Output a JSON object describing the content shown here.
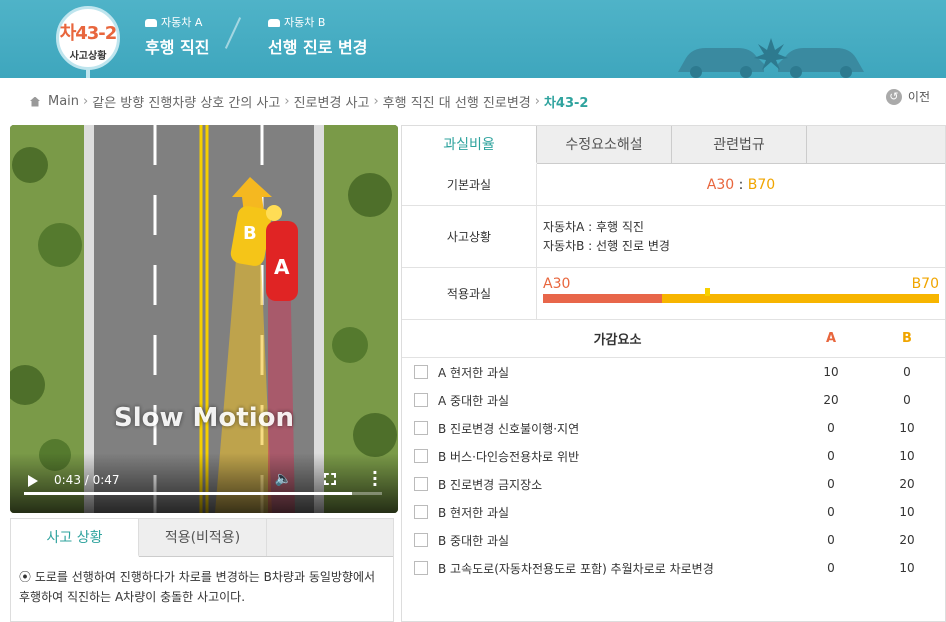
{
  "header": {
    "badge_code": "차43-2",
    "badge_sub": "사고상황",
    "car_a_label": "자동차 A",
    "car_a_action": "후행 직진",
    "car_b_label": "자동차 B",
    "car_b_action": "선행 진로 변경"
  },
  "breadcrumb": [
    "Main",
    "같은 방향 진행차량 상호 간의 사고",
    "진로변경 사고",
    "후행 직진 대 선행 진로변경",
    "차43-2"
  ],
  "back_label": "이전",
  "video": {
    "overlay_text": "Slow Motion",
    "car_a_label": "A",
    "car_b_label": "B",
    "time": "0:43 / 0:47",
    "progress": 0.915
  },
  "lower_tabs": [
    "사고 상황",
    "적용(비적용)"
  ],
  "lower_desc": "⦿ 도로를 선행하여 진행하다가 차로를 변경하는 B차량과 동일방향에서 후행하여 직진하는 A차량이 충돌한 사고이다.",
  "right_tabs": [
    "과실비율",
    "수정요소해설",
    "관련법규"
  ],
  "basic_fault": {
    "label": "기본과실",
    "a": "A30",
    "sep": " : ",
    "b": "B70"
  },
  "situation": {
    "label": "사고상황",
    "line1": "자동차A : 후행 직진",
    "line2": "자동차B : 선행 진로 변경"
  },
  "applied_fault": {
    "label": "적용과실",
    "a": "A30",
    "b": "B70",
    "a_ratio": 0.3
  },
  "adjust": {
    "title": "가감요소",
    "col_a": "A",
    "col_b": "B",
    "rows": [
      {
        "label": "A 현저한 과실",
        "a": "10",
        "b": "0"
      },
      {
        "label": "A 중대한 과실",
        "a": "20",
        "b": "0"
      },
      {
        "label": "B 진로변경 신호불이행·지연",
        "a": "0",
        "b": "10"
      },
      {
        "label": "B 버스·다인승전용차로 위반",
        "a": "0",
        "b": "10"
      },
      {
        "label": "B 진로변경 금지장소",
        "a": "0",
        "b": "20"
      },
      {
        "label": "B 현저한 과실",
        "a": "0",
        "b": "10"
      },
      {
        "label": "B 중대한 과실",
        "a": "0",
        "b": "20"
      },
      {
        "label": "B 고속도로(자동차전용도로 포함) 추월차로로 차로변경",
        "a": "0",
        "b": "10"
      }
    ]
  },
  "colors": {
    "accent": "#2fa39e",
    "header": "#46adc3",
    "car_a": "#e8663d",
    "car_b": "#f0a500"
  }
}
